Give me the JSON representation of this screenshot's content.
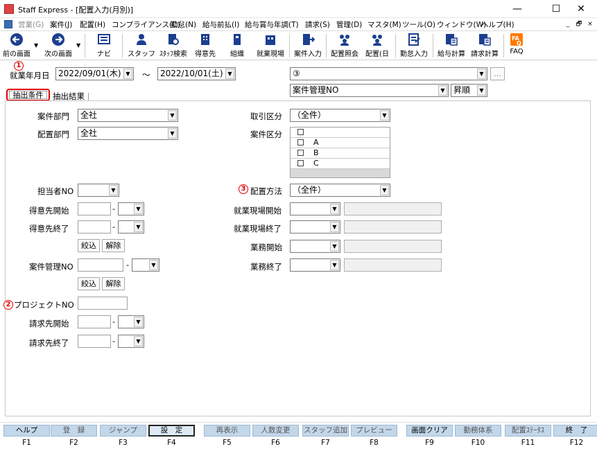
{
  "window": {
    "title": "Staff Express - [配置入力(月別)]",
    "minimize": "—",
    "maximize": "☐",
    "close": "✕"
  },
  "menu": [
    {
      "label": "営業(G)",
      "disabled": true
    },
    {
      "label": "案件(J)",
      "disabled": false
    },
    {
      "label": "配置(H)",
      "disabled": false
    },
    {
      "label": "コンプライアンス(C)",
      "disabled": false
    },
    {
      "label": "勤怠(N)",
      "disabled": false
    },
    {
      "label": "給与前払(I)",
      "disabled": false
    },
    {
      "label": "給与賞与年調(T)",
      "disabled": false
    },
    {
      "label": "請求(S)",
      "disabled": false
    },
    {
      "label": "管理(D)",
      "disabled": false
    },
    {
      "label": "マスタ(M)",
      "disabled": false
    },
    {
      "label": "ツール(O)",
      "disabled": false
    },
    {
      "label": "ウィンドウ(W)",
      "disabled": false
    },
    {
      "label": "ヘルプ(H)",
      "disabled": false
    }
  ],
  "mdi": {
    "min": "_",
    "restore": "🗗",
    "close": "×"
  },
  "toolbar": {
    "prev": "前の画面",
    "next": "次の画面",
    "navi": "ナビ",
    "staff": "スタッフ",
    "staff_search": "ｽﾀｯﾌ検索",
    "customer": "得意先",
    "org": "組織",
    "worksite": "就業現場",
    "case_input": "案件入力",
    "assign_ref": "配置照会",
    "assign_day": "配置(日",
    "attendance": "勤怠入力",
    "payroll": "給与計算",
    "billing": "請求計算",
    "faq": "FAQ"
  },
  "period": {
    "label": "就業年月日",
    "from": "2022/09/01(木)",
    "tilde": "～",
    "to": "2022/10/01(土)"
  },
  "right_top": {
    "pattern_value": "③",
    "ellipsis": "...",
    "sort_field": "案件管理NO",
    "sort_order": "昇順"
  },
  "tabs": {
    "criteria": "抽出条件",
    "results": "抽出結果"
  },
  "markers": {
    "m1": "1",
    "m2": "2",
    "m3": "3"
  },
  "left": {
    "case_dept_label": "案件部門",
    "case_dept_value": "全社",
    "assign_dept_label": "配置部門",
    "assign_dept_value": "全社",
    "staff_no_label": "担当者NO",
    "cust_start_label": "得意先開始",
    "cust_end_label": "得意先終了",
    "dash": "-",
    "filter_btn": "絞込",
    "clear_btn": "解除",
    "case_mgmt_label": "案件管理NO",
    "project_label": "プロジェクトNO",
    "bill_start_label": "請求先開始",
    "bill_end_label": "請求先終了"
  },
  "right": {
    "trade_label": "取引区分",
    "trade_value": "（全件）",
    "case_type_label": "案件区分",
    "case_type_items": [
      "",
      "A",
      "B",
      "C"
    ],
    "assign_method_label": "配置方法",
    "assign_method_value": "（全件）",
    "site_start_label": "就業現場開始",
    "site_end_label": "就業現場終了",
    "work_start_label": "業務開始",
    "work_end_label": "業務終了"
  },
  "fkeys": [
    {
      "label": "ヘルプ",
      "key": "F1",
      "enabled": true,
      "selected": false
    },
    {
      "label": "登　録",
      "key": "F2",
      "enabled": false,
      "selected": false
    },
    {
      "label": "ジャンプ",
      "key": "F3",
      "enabled": false,
      "selected": false
    },
    {
      "label": "設　定",
      "key": "F4",
      "enabled": true,
      "selected": true
    },
    {
      "label": "再表示",
      "key": "F5",
      "enabled": false,
      "selected": false
    },
    {
      "label": "人数変更",
      "key": "F6",
      "enabled": false,
      "selected": false
    },
    {
      "label": "スタッフ追加",
      "key": "F7",
      "enabled": false,
      "selected": false
    },
    {
      "label": "プレビュー",
      "key": "F8",
      "enabled": false,
      "selected": false
    },
    {
      "label": "画面クリア",
      "key": "F9",
      "enabled": true,
      "selected": false
    },
    {
      "label": "勤務体系",
      "key": "F10",
      "enabled": false,
      "selected": false
    },
    {
      "label": "配置ｽﾃｰﾀｽ",
      "key": "F11",
      "enabled": false,
      "selected": false
    },
    {
      "label": "終　了",
      "key": "F12",
      "enabled": true,
      "selected": false
    }
  ]
}
